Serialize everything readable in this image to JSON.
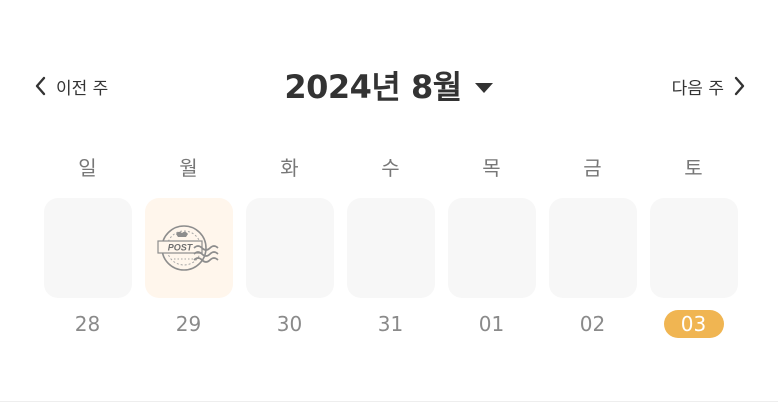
{
  "nav": {
    "prev_label": "이전 주",
    "next_label": "다음 주"
  },
  "title": {
    "month_label": "2024년 8월"
  },
  "week": [
    {
      "weekday": "일",
      "date": "28",
      "stamp": false,
      "today": false
    },
    {
      "weekday": "월",
      "date": "29",
      "stamp": true,
      "today": false,
      "stamp_text": "POST"
    },
    {
      "weekday": "화",
      "date": "30",
      "stamp": false,
      "today": false
    },
    {
      "weekday": "수",
      "date": "31",
      "stamp": false,
      "today": false
    },
    {
      "weekday": "목",
      "date": "01",
      "stamp": false,
      "today": false
    },
    {
      "weekday": "금",
      "date": "02",
      "stamp": false,
      "today": false
    },
    {
      "weekday": "토",
      "date": "03",
      "stamp": false,
      "today": true
    }
  ],
  "colors": {
    "today_badge": "#f0b552",
    "tile": "#f7f7f7",
    "stamp_tile": "#fff6ec"
  },
  "icons": {
    "prev": "chevron-left-icon",
    "next": "chevron-right-icon",
    "dropdown": "caret-down-icon",
    "stamp": "post-stamp-icon"
  }
}
